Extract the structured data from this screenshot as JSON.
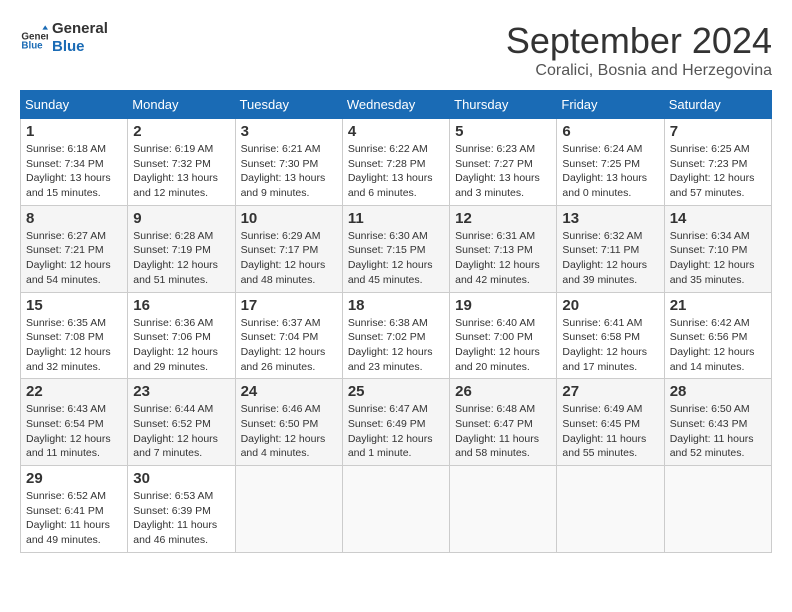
{
  "logo": {
    "line1": "General",
    "line2": "Blue"
  },
  "title": "September 2024",
  "location": "Coralici, Bosnia and Herzegovina",
  "days_of_week": [
    "Sunday",
    "Monday",
    "Tuesday",
    "Wednesday",
    "Thursday",
    "Friday",
    "Saturday"
  ],
  "weeks": [
    [
      {
        "day": "1",
        "sunrise": "6:18 AM",
        "sunset": "7:34 PM",
        "daylight": "13 hours and 15 minutes."
      },
      {
        "day": "2",
        "sunrise": "6:19 AM",
        "sunset": "7:32 PM",
        "daylight": "13 hours and 12 minutes."
      },
      {
        "day": "3",
        "sunrise": "6:21 AM",
        "sunset": "7:30 PM",
        "daylight": "13 hours and 9 minutes."
      },
      {
        "day": "4",
        "sunrise": "6:22 AM",
        "sunset": "7:28 PM",
        "daylight": "13 hours and 6 minutes."
      },
      {
        "day": "5",
        "sunrise": "6:23 AM",
        "sunset": "7:27 PM",
        "daylight": "13 hours and 3 minutes."
      },
      {
        "day": "6",
        "sunrise": "6:24 AM",
        "sunset": "7:25 PM",
        "daylight": "13 hours and 0 minutes."
      },
      {
        "day": "7",
        "sunrise": "6:25 AM",
        "sunset": "7:23 PM",
        "daylight": "12 hours and 57 minutes."
      }
    ],
    [
      {
        "day": "8",
        "sunrise": "6:27 AM",
        "sunset": "7:21 PM",
        "daylight": "12 hours and 54 minutes."
      },
      {
        "day": "9",
        "sunrise": "6:28 AM",
        "sunset": "7:19 PM",
        "daylight": "12 hours and 51 minutes."
      },
      {
        "day": "10",
        "sunrise": "6:29 AM",
        "sunset": "7:17 PM",
        "daylight": "12 hours and 48 minutes."
      },
      {
        "day": "11",
        "sunrise": "6:30 AM",
        "sunset": "7:15 PM",
        "daylight": "12 hours and 45 minutes."
      },
      {
        "day": "12",
        "sunrise": "6:31 AM",
        "sunset": "7:13 PM",
        "daylight": "12 hours and 42 minutes."
      },
      {
        "day": "13",
        "sunrise": "6:32 AM",
        "sunset": "7:11 PM",
        "daylight": "12 hours and 39 minutes."
      },
      {
        "day": "14",
        "sunrise": "6:34 AM",
        "sunset": "7:10 PM",
        "daylight": "12 hours and 35 minutes."
      }
    ],
    [
      {
        "day": "15",
        "sunrise": "6:35 AM",
        "sunset": "7:08 PM",
        "daylight": "12 hours and 32 minutes."
      },
      {
        "day": "16",
        "sunrise": "6:36 AM",
        "sunset": "7:06 PM",
        "daylight": "12 hours and 29 minutes."
      },
      {
        "day": "17",
        "sunrise": "6:37 AM",
        "sunset": "7:04 PM",
        "daylight": "12 hours and 26 minutes."
      },
      {
        "day": "18",
        "sunrise": "6:38 AM",
        "sunset": "7:02 PM",
        "daylight": "12 hours and 23 minutes."
      },
      {
        "day": "19",
        "sunrise": "6:40 AM",
        "sunset": "7:00 PM",
        "daylight": "12 hours and 20 minutes."
      },
      {
        "day": "20",
        "sunrise": "6:41 AM",
        "sunset": "6:58 PM",
        "daylight": "12 hours and 17 minutes."
      },
      {
        "day": "21",
        "sunrise": "6:42 AM",
        "sunset": "6:56 PM",
        "daylight": "12 hours and 14 minutes."
      }
    ],
    [
      {
        "day": "22",
        "sunrise": "6:43 AM",
        "sunset": "6:54 PM",
        "daylight": "12 hours and 11 minutes."
      },
      {
        "day": "23",
        "sunrise": "6:44 AM",
        "sunset": "6:52 PM",
        "daylight": "12 hours and 7 minutes."
      },
      {
        "day": "24",
        "sunrise": "6:46 AM",
        "sunset": "6:50 PM",
        "daylight": "12 hours and 4 minutes."
      },
      {
        "day": "25",
        "sunrise": "6:47 AM",
        "sunset": "6:49 PM",
        "daylight": "12 hours and 1 minute."
      },
      {
        "day": "26",
        "sunrise": "6:48 AM",
        "sunset": "6:47 PM",
        "daylight": "11 hours and 58 minutes."
      },
      {
        "day": "27",
        "sunrise": "6:49 AM",
        "sunset": "6:45 PM",
        "daylight": "11 hours and 55 minutes."
      },
      {
        "day": "28",
        "sunrise": "6:50 AM",
        "sunset": "6:43 PM",
        "daylight": "11 hours and 52 minutes."
      }
    ],
    [
      {
        "day": "29",
        "sunrise": "6:52 AM",
        "sunset": "6:41 PM",
        "daylight": "11 hours and 49 minutes."
      },
      {
        "day": "30",
        "sunrise": "6:53 AM",
        "sunset": "6:39 PM",
        "daylight": "11 hours and 46 minutes."
      },
      null,
      null,
      null,
      null,
      null
    ]
  ]
}
